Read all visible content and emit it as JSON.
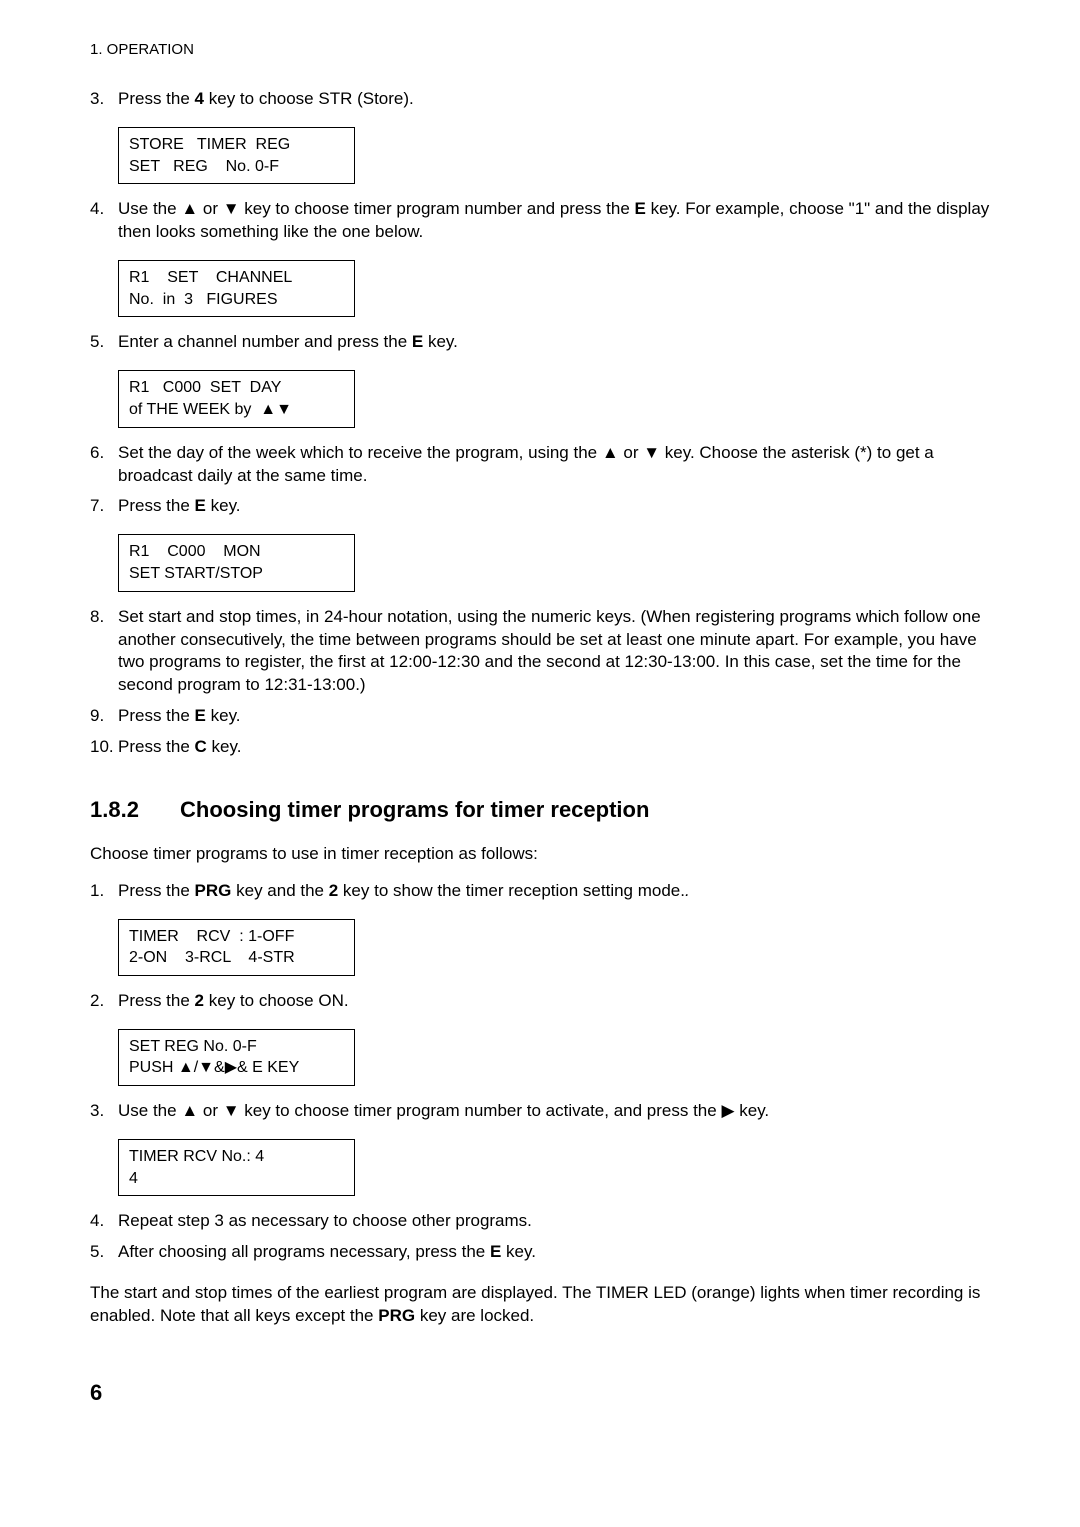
{
  "header": "1. OPERATION",
  "s3": {
    "num": "3.",
    "text_a": "Press the ",
    "key": "4",
    "text_b": " key to choose STR (Store)."
  },
  "lcd3": "STORE   TIMER  REG\nSET   REG    No. 0-F",
  "s4": {
    "num": "4.",
    "text_a": "Use the ",
    "text_b": " or ",
    "text_c": " key to choose timer program number and press the ",
    "key": "E",
    "text_d": " key. For example, choose \"1\" and the display then looks something like the one below."
  },
  "lcd4": "R1    SET    CHANNEL\nNo.  in  3   FIGURES",
  "s5": {
    "num": "5.",
    "text_a": "Enter a channel number and press the ",
    "key": "E",
    "text_b": " key."
  },
  "lcd5": "R1   C000  SET  DAY\nof THE WEEK by  ▲▼",
  "s6": {
    "num": "6.",
    "text_a": "Set the day of the week which to receive the program, using the ",
    "text_b": " or ",
    "text_c": " key. Choose the asterisk (*) to get a broadcast daily at the same time."
  },
  "s7": {
    "num": "7.",
    "text_a": "Press the ",
    "key": "E",
    "text_b": " key."
  },
  "lcd7": "R1    C000    MON\nSET START/STOP",
  "s8": {
    "num": "8.",
    "text": "Set start and stop times, in 24-hour notation, using the numeric keys. (When registering programs which follow one another consecutively, the time between programs should be set at least one minute apart. For example, you have two programs to register, the first at 12:00-12:30 and the second at 12:30-13:00. In this case, set the time for the second program to 12:31-13:00.)"
  },
  "s9": {
    "num": "9.",
    "text_a": "Press the ",
    "key": "E",
    "text_b": " key."
  },
  "s10": {
    "num": "10.",
    "text_a": "Press the ",
    "key": "C",
    "text_b": " key."
  },
  "h2": {
    "num": "1.8.2",
    "title": "Choosing timer programs for timer reception"
  },
  "intro2": "Choose timer programs to use in timer reception as follows:",
  "b1": {
    "num": "1.",
    "text_a": "Press the ",
    "key1": "PRG",
    "text_b": " key and the ",
    "key2": "2",
    "text_c": " key to show the timer reception setting mode."
  },
  "lcdb1": "TIMER    RCV  : 1-OFF\n2-ON    3-RCL    4-STR",
  "b2": {
    "num": "2.",
    "text_a": "Press the ",
    "key": "2",
    "text_b": " key to choose ON."
  },
  "lcdb2": "SET REG No. 0-F\nPUSH ▲/▼&▶& E KEY",
  "b3": {
    "num": "3.",
    "text_a": "Use the ",
    "text_b": " or ",
    "text_c": " key to choose timer program number to activate, and press the ",
    "text_d": " key."
  },
  "lcdb3": "TIMER RCV No.: 4\n4",
  "b4": {
    "num": "4.",
    "text": "Repeat step 3 as necessary to choose other programs."
  },
  "b5": {
    "num": "5.",
    "text_a": "After choosing all programs necessary, press the ",
    "key": "E",
    "text_b": " key."
  },
  "closing_a": "The start and stop times of the earliest program are displayed. The TIMER LED (orange) lights when timer recording is enabled. Note that all keys except the ",
  "closing_key": "PRG",
  "closing_b": " key are locked.",
  "pagenum": "6"
}
